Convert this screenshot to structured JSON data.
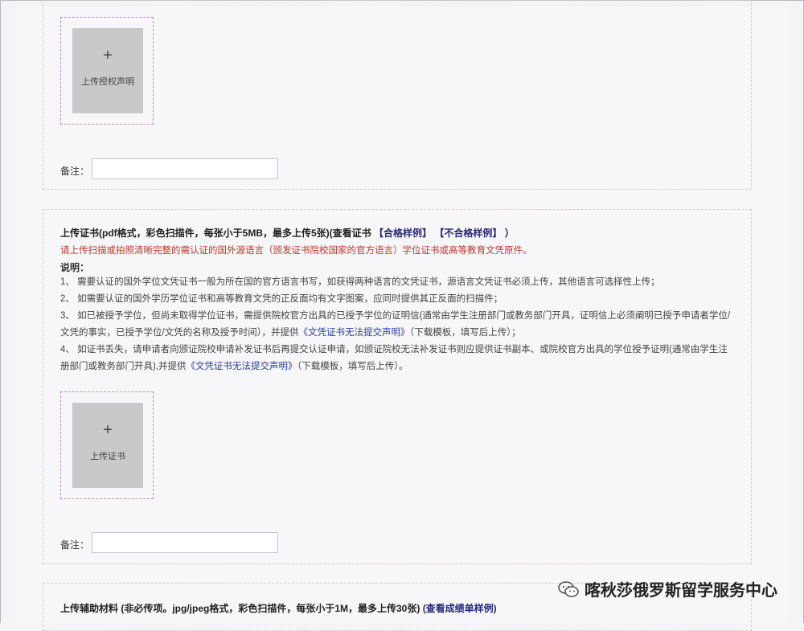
{
  "section1": {
    "upload_label": "上传授权声明",
    "plus": "+",
    "remark_label": "备注："
  },
  "section2": {
    "title_prefix": "上传证书(pdf格式，彩色扫描件，每张小于5MB，最多上传5张)(查看证书",
    "link_pass": "【合格样例】",
    "link_fail": "【不合格样例】",
    "title_suffix": "）",
    "warning": "请上传扫描或拍照清晰完整的需认证的国外源语言（颁发证书院校国家的官方语言）学位证书或高等教育文凭原件。",
    "notes_heading": "说明：",
    "note1": "1、 需要认证的国外学位文凭证书一般为所在国的官方语言书写，如获得两种语言的文凭证书，源语言文凭证书必须上传，其他语言可选择性上传；",
    "note2": "2、 如需要认证的国外学历学位证书和高等教育文凭的正反面均有文字图案，应同时提供其正反面的扫描件；",
    "note3_a": "3、 如已被授予学位，但尚未取得学位证书，需提供院校官方出具的已授予学位的证明信(通常由学生注册部门或教务部门开具，证明信上必须阐明已授予申请者学位/文凭的事实，已授予学位/文凭的名称及授予时间），并提供",
    "note3_link": "《文凭证书无法提交声明》",
    "note3_b": "（下载模板，填写后上传）；",
    "note4_a": "4、 如证书丢失，请申请者向颁证院校申请补发证书后再提交认证申请，如颁证院校无法补发证书则应提供证书副本、或院校官方出具的学位授予证明(通常由学生注册部门或教务部门开具),并提供",
    "note4_link": "《文凭证书无法提交声明》",
    "note4_b": "（下载模板，填写后上传）。",
    "upload_label": "上传证书",
    "plus": "+",
    "remark_label": "备注："
  },
  "section3": {
    "title_prefix": "上传辅助材料 (非必传项。jpg/jpeg格式，彩色扫描件，每张小于1M，最多上传30张)",
    "title_link": "(查看成绩单样例)"
  },
  "watermark": {
    "text": "喀秋莎俄罗斯留学服务中心",
    "icon": "wechat-icon"
  }
}
